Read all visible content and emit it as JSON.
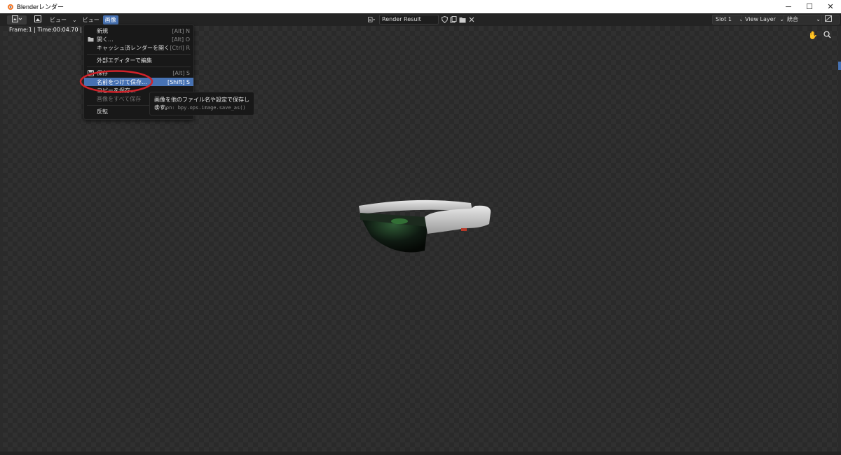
{
  "window": {
    "title": "Blenderレンダー",
    "controls": {
      "minimize": "─",
      "maximize": "☐",
      "close": "✕"
    }
  },
  "header": {
    "menus": [
      {
        "label": "ビュー",
        "dropdown": "⌄"
      },
      {
        "label": "ビュー"
      },
      {
        "label": "画像",
        "active": true
      }
    ],
    "image_name": "Render Result",
    "slot": "Slot 1",
    "view_layer": "View Layer",
    "pass": "統合"
  },
  "viewport": {
    "frame_info": "Frame:1 | Time:00:04.70 | Mem:1"
  },
  "image_menu": {
    "items": [
      {
        "label": "新規",
        "shortcut": "[Alt] N",
        "icon": ""
      },
      {
        "label": "開く...",
        "shortcut": "[Alt] O",
        "icon": "folder-icon"
      },
      {
        "label": "キャッシュ済レンダーを開く",
        "shortcut": "[Ctrl] R",
        "icon": ""
      },
      {
        "label": "外部エディターで編集",
        "shortcut": "",
        "icon": ""
      },
      {
        "label": "保存",
        "shortcut": "[Alt] S",
        "icon": "save-icon"
      },
      {
        "label": "名前をつけて保存...",
        "shortcut": "[Shift] S",
        "icon": "",
        "highlighted": true
      },
      {
        "label": "コピーを保存...",
        "shortcut": "",
        "icon": ""
      },
      {
        "label": "画像をすべて保存",
        "shortcut": "",
        "icon": "",
        "disabled": true
      },
      {
        "label": "反転",
        "shortcut": "",
        "icon": ""
      }
    ]
  },
  "tooltip": {
    "description": "画像を他のファイル名や設定で保存します。",
    "python": "Python: bpy.ops.image.save_as()"
  },
  "colors": {
    "highlight": "#4772b3",
    "annotation": "#d0222a"
  },
  "icons": {
    "hand": "hand-icon",
    "zoom": "zoom-icon"
  }
}
